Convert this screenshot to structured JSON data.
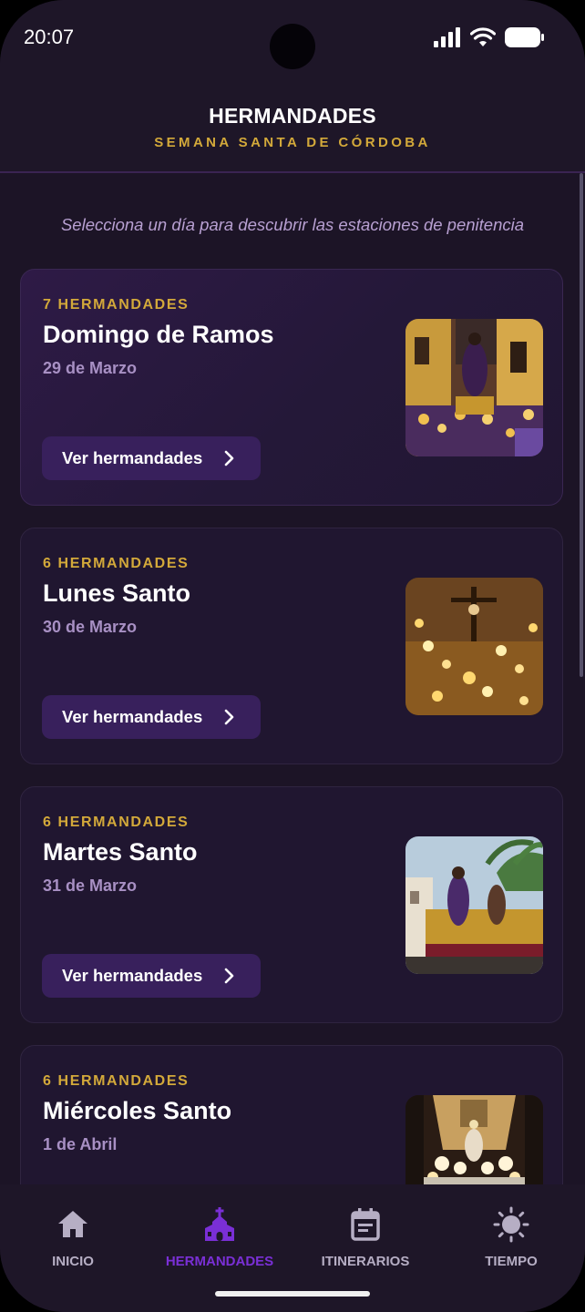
{
  "status_bar": {
    "time": "20:07"
  },
  "header": {
    "title": "HERMANDADES",
    "subtitle": "SEMANA SANTA DE CÓRDOBA"
  },
  "intro_text": "Selecciona un día para descubrir las estaciones de penitencia",
  "days": [
    {
      "count_label": "7 HERMANDADES",
      "name": "Domingo de Ramos",
      "date": "29 de Marzo",
      "button_label": "Ver hermandades"
    },
    {
      "count_label": "6 HERMANDADES",
      "name": "Lunes Santo",
      "date": "30 de Marzo",
      "button_label": "Ver hermandades"
    },
    {
      "count_label": "6 HERMANDADES",
      "name": "Martes Santo",
      "date": "31 de Marzo",
      "button_label": "Ver hermandades"
    },
    {
      "count_label": "6 HERMANDADES",
      "name": "Miércoles Santo",
      "date": "1 de Abril"
    }
  ],
  "bottom_nav": [
    {
      "label": "INICIO",
      "icon": "home-icon"
    },
    {
      "label": "HERMANDADES",
      "icon": "church-icon",
      "active": true
    },
    {
      "label": "ITINERARIOS",
      "icon": "calendar-icon"
    },
    {
      "label": "TIEMPO",
      "icon": "sun-icon"
    }
  ],
  "colors": {
    "accent_gold": "#d3a93a",
    "accent_purple": "#7a2fd6",
    "background": "#1c1426"
  }
}
